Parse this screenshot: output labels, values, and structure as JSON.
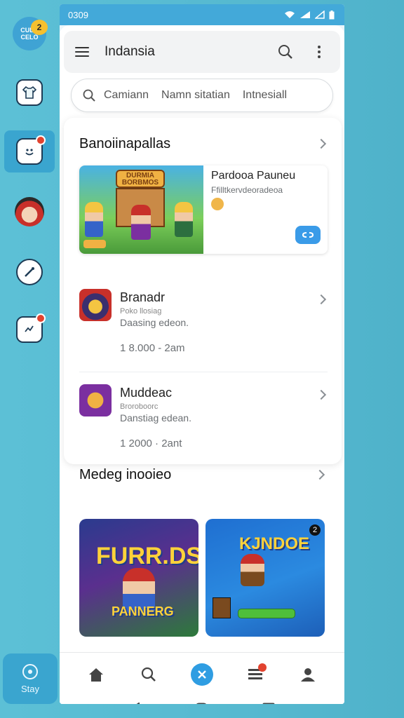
{
  "status": {
    "time": "0309"
  },
  "rail": {
    "logo_text": "CULO\nCELO",
    "logo_count": "2",
    "bottom_label": "Stay"
  },
  "header": {
    "title": "Indansia"
  },
  "search": {
    "placeholder": "Camiann",
    "chips": [
      "Namn sitatian",
      "Intnesiall"
    ]
  },
  "section1": {
    "title": "Banoiinapallas",
    "feature": {
      "title": "Pardooa Pauneu",
      "subtitle": "Ffilltkervdeoradeoa",
      "art_text": "DURMIA BORBMOS"
    },
    "items": [
      {
        "title": "Branadr",
        "meta": "Poko llosiag",
        "description": "Daasing edeon.",
        "time": "1 8.000 - 2am"
      },
      {
        "title": "Muddeac",
        "meta": "Broroboorc",
        "description": "Danstiag edean.",
        "time": "1 2000 · 2ant"
      }
    ]
  },
  "section2": {
    "title": "Medeg inooieo",
    "tiles": [
      {
        "title": "FURR.DS",
        "subtitle": "PANNERG"
      },
      {
        "title": "KJNDOE",
        "badge": "2"
      }
    ]
  },
  "colors": {
    "accent": "#2f9de2",
    "status_bar": "#43a9d9",
    "background": "#56b9d0"
  }
}
